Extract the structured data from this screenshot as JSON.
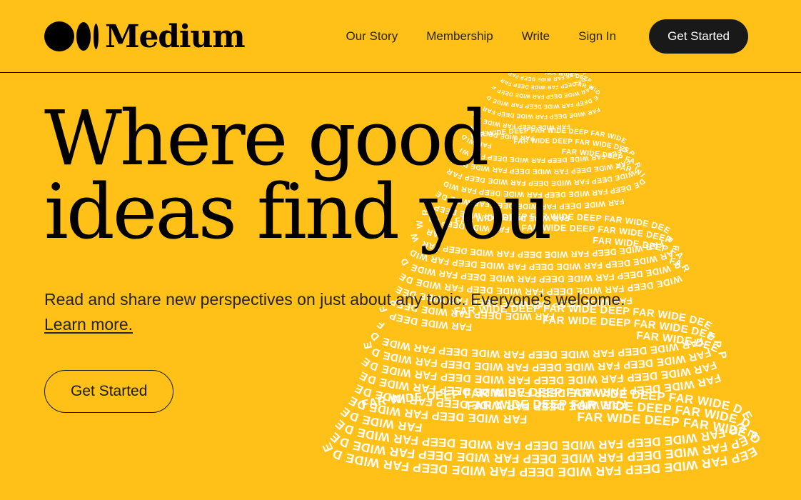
{
  "theme": {
    "background": "#FFC017",
    "ink": "#242424",
    "dark": "#191919",
    "white": "#FFFFFF"
  },
  "header": {
    "brand": {
      "mark_icon": "medium-logo-mark",
      "wordmark": "Medium"
    },
    "nav": [
      {
        "label": "Our Story",
        "name": "nav-our-story"
      },
      {
        "label": "Membership",
        "name": "nav-membership"
      },
      {
        "label": "Write",
        "name": "nav-write"
      },
      {
        "label": "Sign In",
        "name": "nav-sign-in"
      }
    ],
    "cta_label": "Get Started"
  },
  "hero": {
    "title": "Where good\nideas find you",
    "subtitle_before": "Read and share new perspectives on just about any topic. Everyone's welcome. ",
    "subtitle_link": "Learn more.",
    "cta_label": "Get Started"
  },
  "illustration": {
    "name": "far-wide-deep-cone",
    "ring_text": "FAR WIDE DEEP",
    "text_color": "#FFFFFF"
  }
}
